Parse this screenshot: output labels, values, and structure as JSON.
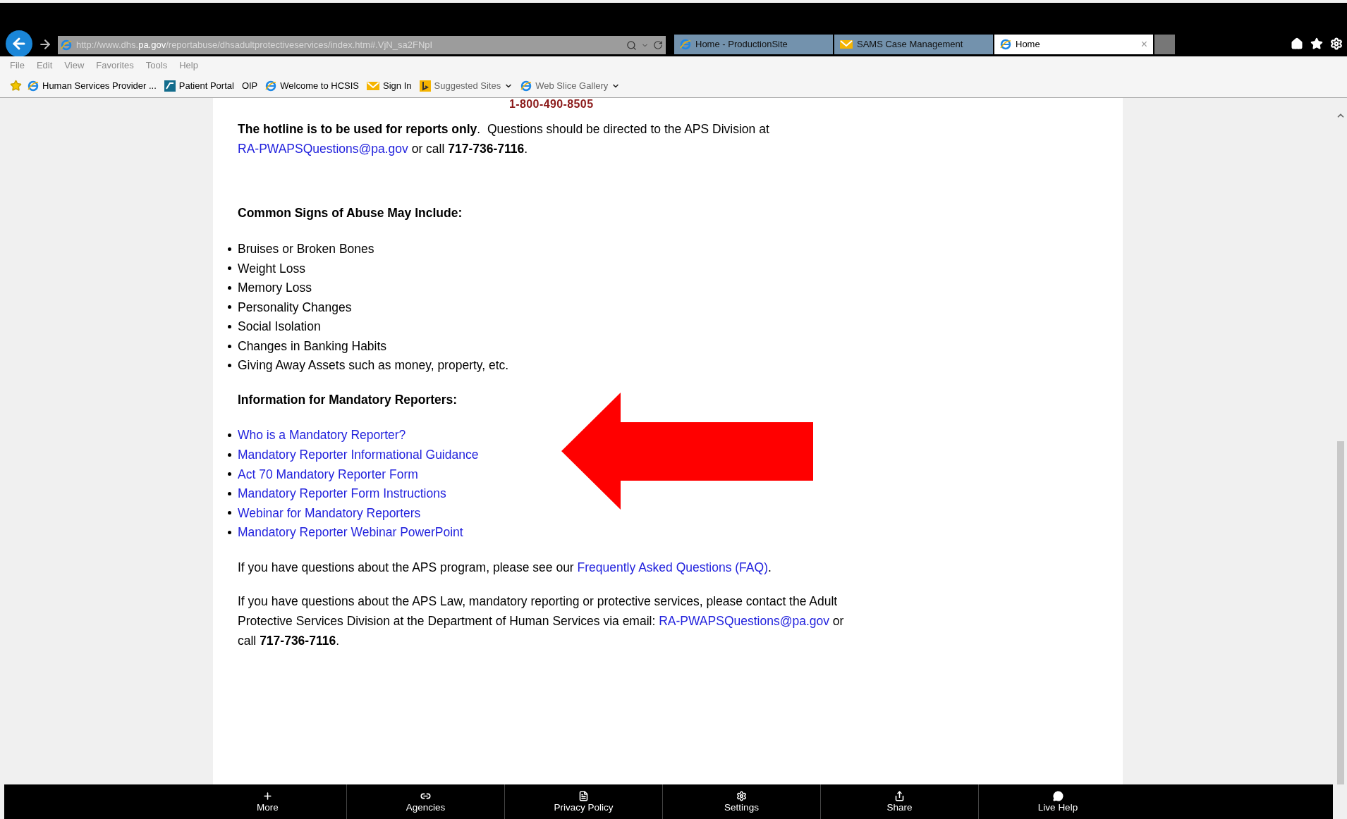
{
  "browser": {
    "address": "http://www.dhs.**pa.gov**/reportabuse/dhsadultprotectiveservices/index.htm#.VjN_sa2FNpI",
    "tabs": [
      {
        "label": "Home - ProductionSite",
        "selected": false
      },
      {
        "label": "SAMS Case Management",
        "selected": false
      },
      {
        "label": "Home",
        "selected": true,
        "close": "×"
      }
    ],
    "menu": [
      "File",
      "Edit",
      "View",
      "Favorites",
      "Tools",
      "Help"
    ],
    "favorites": [
      {
        "label": "Human Services Provider ...",
        "kind": "link"
      },
      {
        "label": "Patient Portal",
        "kind": "link"
      },
      {
        "label": "OIP",
        "kind": "link"
      },
      {
        "label": "Welcome to HCSIS",
        "kind": "link"
      },
      {
        "label": "Sign In",
        "kind": "link"
      },
      {
        "label": "Suggested Sites",
        "kind": "dropdown"
      },
      {
        "label": "Web Slice Gallery",
        "kind": "dropdown"
      }
    ]
  },
  "page": {
    "phone": "1-800-490-8505",
    "hotline_paragraph": [
      {
        "text": "The hotline is to be used for reports only",
        "kind": "bold"
      },
      {
        "text": ".  Questions should be directed to the APS Division at ",
        "kind": "plain"
      },
      {
        "text": "RA-PWAPSQuestions@pa.gov",
        "kind": "link"
      },
      {
        "text": " or call ",
        "kind": "plain"
      },
      {
        "text": "717-736-7116",
        "kind": "bold"
      },
      {
        "text": ".",
        "kind": "plain"
      }
    ],
    "signs_heading": "Common Signs of Abuse May Include:",
    "signs": [
      "Bruises or Broken Bones",
      "Weight Loss",
      "Memory Loss",
      "Personality Changes",
      "Social Isolation",
      "Changes in Banking Habits",
      "Giving Away Assets such as money, property, etc."
    ],
    "reporters_heading": "Information for Mandatory Reporters:",
    "reporter_links": [
      "Who is a Mandatory Reporter?",
      "Mandatory Reporter Informational Guidance",
      "Act 70 Mandatory Reporter Form",
      "Mandatory Reporter Form Instructions",
      "Webinar for Mandatory Reporters",
      "Mandatory Reporter Webinar PowerPoint"
    ],
    "faq_paragraph": [
      {
        "text": "If you have questions about the APS program, please see our ",
        "kind": "plain"
      },
      {
        "text": "Frequently Asked Questions (FAQ)",
        "kind": "link"
      },
      {
        "text": ".",
        "kind": "plain"
      }
    ],
    "contact_paragraph": [
      {
        "text": "If you have questions about the APS Law, mandatory reporting or protective services, please contact the Adult Protective Services Division at the Department of Human Services via email: ",
        "kind": "plain"
      },
      {
        "text": "RA-PWAPSQuestions@pa.gov",
        "kind": "link"
      },
      {
        "text": " or call ",
        "kind": "plain"
      },
      {
        "text": "717-736-7116",
        "kind": "bold"
      },
      {
        "text": ".",
        "kind": "plain"
      }
    ],
    "annotation": {
      "kind": "arrow"
    }
  },
  "footer": [
    {
      "label": "More"
    },
    {
      "label": "Agencies"
    },
    {
      "label": "Privacy Policy"
    },
    {
      "label": "Settings"
    },
    {
      "label": "Share"
    },
    {
      "label": "Live Help"
    }
  ]
}
